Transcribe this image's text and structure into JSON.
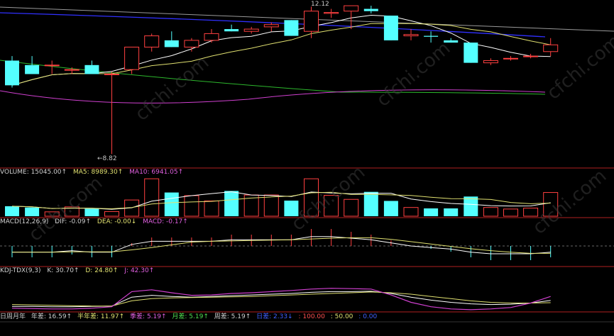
{
  "colors": {
    "up": "#ff4040",
    "down": "#54ffff",
    "ma_white": "#ffffff",
    "ma_yellow": "#e0e070",
    "ma_green": "#2db82d",
    "ma_magenta": "#d040d0",
    "ma_blue": "#3030ff",
    "ma_gray": "#9a9a9a",
    "panel_border": "#b02020"
  },
  "price_panel": {
    "high_marker": "12.12",
    "low_marker": "←8.82"
  },
  "volume_header": {
    "volume": "VOLUME: 15045.00↑",
    "ma5": "MA5: 8989.30↑",
    "ma10": "MA10: 6941.05↑"
  },
  "macd_header": {
    "name": "MACD(12,26,9)",
    "dif": "DIF: -0.09↑",
    "dea": "DEA: -0.00↓",
    "macd": "MACD: -0.17↑"
  },
  "kdj_header": {
    "name": "KDJ-TDX(9,3)",
    "k": "K: 30.70↑",
    "d": "D: 24.80↑",
    "j": "J: 42.30↑"
  },
  "bottom_bar": {
    "period": "日周月年",
    "year": "年差: 16.59↑",
    "half_year": "半年差: 11.97↑",
    "quarter": "季差: 5.19↑",
    "month": "月差: 5.19↑",
    "week": "周差: 5.19↑",
    "day": "日差: 2.33↓",
    "level100": ": 100.00",
    "level50": ": 50.00",
    "level0": ": 0.00"
  },
  "watermark": "cfchi.com",
  "chart_data": {
    "type": "candlestick",
    "candles": [
      {
        "o": 10.9,
        "h": 11.0,
        "l": 10.3,
        "c": 10.35
      },
      {
        "o": 10.8,
        "h": 11.0,
        "l": 10.6,
        "c": 10.6
      },
      {
        "o": 10.8,
        "h": 10.9,
        "l": 10.6,
        "c": 10.8
      },
      {
        "o": 10.7,
        "h": 10.75,
        "l": 10.6,
        "c": 10.7
      },
      {
        "o": 10.8,
        "h": 10.9,
        "l": 10.6,
        "c": 10.6
      },
      {
        "o": 10.6,
        "h": 10.65,
        "l": 8.82,
        "c": 10.6
      },
      {
        "o": 10.7,
        "h": 11.2,
        "l": 10.6,
        "c": 11.2
      },
      {
        "o": 11.2,
        "h": 11.5,
        "l": 11.1,
        "c": 11.45
      },
      {
        "o": 11.35,
        "h": 11.55,
        "l": 11.2,
        "c": 11.2
      },
      {
        "o": 11.2,
        "h": 11.4,
        "l": 11.1,
        "c": 11.35
      },
      {
        "o": 11.35,
        "h": 11.6,
        "l": 11.3,
        "c": 11.5
      },
      {
        "o": 11.6,
        "h": 11.7,
        "l": 11.55,
        "c": 11.55
      },
      {
        "o": 11.55,
        "h": 11.65,
        "l": 11.5,
        "c": 11.6
      },
      {
        "o": 11.65,
        "h": 11.75,
        "l": 11.55,
        "c": 11.7
      },
      {
        "o": 11.8,
        "h": 11.8,
        "l": 11.45,
        "c": 11.45
      },
      {
        "o": 11.55,
        "h": 12.1,
        "l": 11.4,
        "c": 12.0
      },
      {
        "o": 11.95,
        "h": 12.05,
        "l": 11.85,
        "c": 11.97
      },
      {
        "o": 12.0,
        "h": 12.12,
        "l": 11.6,
        "c": 12.12
      },
      {
        "o": 12.05,
        "h": 12.12,
        "l": 11.95,
        "c": 12.0
      },
      {
        "o": 11.9,
        "h": 11.9,
        "l": 11.35,
        "c": 11.35
      },
      {
        "o": 11.45,
        "h": 11.6,
        "l": 11.35,
        "c": 11.48
      },
      {
        "o": 11.45,
        "h": 11.55,
        "l": 11.3,
        "c": 11.43
      },
      {
        "o": 11.35,
        "h": 11.4,
        "l": 11.3,
        "c": 11.3
      },
      {
        "o": 11.3,
        "h": 11.3,
        "l": 10.85,
        "c": 10.85
      },
      {
        "o": 10.85,
        "h": 10.95,
        "l": 10.8,
        "c": 10.9
      },
      {
        "o": 10.95,
        "h": 11.0,
        "l": 10.9,
        "c": 10.95
      },
      {
        "o": 11.0,
        "h": 11.05,
        "l": 10.95,
        "c": 11.0
      },
      {
        "o": 11.1,
        "h": 11.4,
        "l": 11.0,
        "c": 11.25
      }
    ],
    "volume": [
      3200,
      2800,
      1400,
      3000,
      2400,
      1500,
      5200,
      12000,
      7600,
      6600,
      4900,
      8100,
      6800,
      6800,
      5000,
      12000,
      6700,
      5400,
      7800,
      4900,
      2800,
      2500,
      2500,
      6300,
      2800,
      2300,
      2600,
      7600
    ],
    "macd": [
      -0.04,
      -0.04,
      -0.04,
      -0.03,
      -0.04,
      -0.04,
      0.01,
      0.03,
      0.03,
      0.03,
      0.03,
      0.04,
      0.04,
      0.04,
      0.04,
      0.06,
      0.06,
      0.05,
      0.04,
      0.02,
      0.0,
      -0.01,
      -0.02,
      -0.04,
      -0.05,
      -0.05,
      -0.05,
      -0.04
    ],
    "kdj_k": [
      15,
      15,
      14,
      14,
      15,
      16,
      40,
      45,
      42,
      40,
      42,
      44,
      46,
      48,
      50,
      53,
      55,
      55,
      56,
      50,
      40,
      32,
      26,
      22,
      20,
      21,
      24,
      31
    ],
    "kdj_d": [
      20,
      19,
      18,
      17,
      16,
      16,
      30,
      36,
      38,
      39,
      40,
      41,
      42,
      44,
      46,
      48,
      50,
      52,
      54,
      52,
      48,
      42,
      36,
      30,
      26,
      24,
      24,
      25
    ],
    "kdj_j": [
      10,
      9,
      8,
      8,
      10,
      14,
      55,
      60,
      52,
      45,
      46,
      50,
      52,
      55,
      58,
      62,
      64,
      63,
      62,
      46,
      26,
      14,
      8,
      6,
      8,
      12,
      24,
      42
    ]
  }
}
